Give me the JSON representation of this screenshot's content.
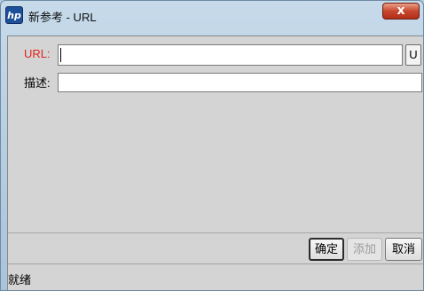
{
  "window": {
    "title": "新参考 - URL",
    "close_label": "x",
    "icon": "hp-logo",
    "icon_text": "hp"
  },
  "form": {
    "url_label": "URL:",
    "url_value": "",
    "url_button_label": "U",
    "description_label": "描述:",
    "description_value": ""
  },
  "buttons": {
    "ok": "确定",
    "add": "添加",
    "cancel": "取消"
  },
  "status": {
    "text": "就绪"
  },
  "colors": {
    "required_label": "#e0241b",
    "close_button": "#c8462e"
  }
}
